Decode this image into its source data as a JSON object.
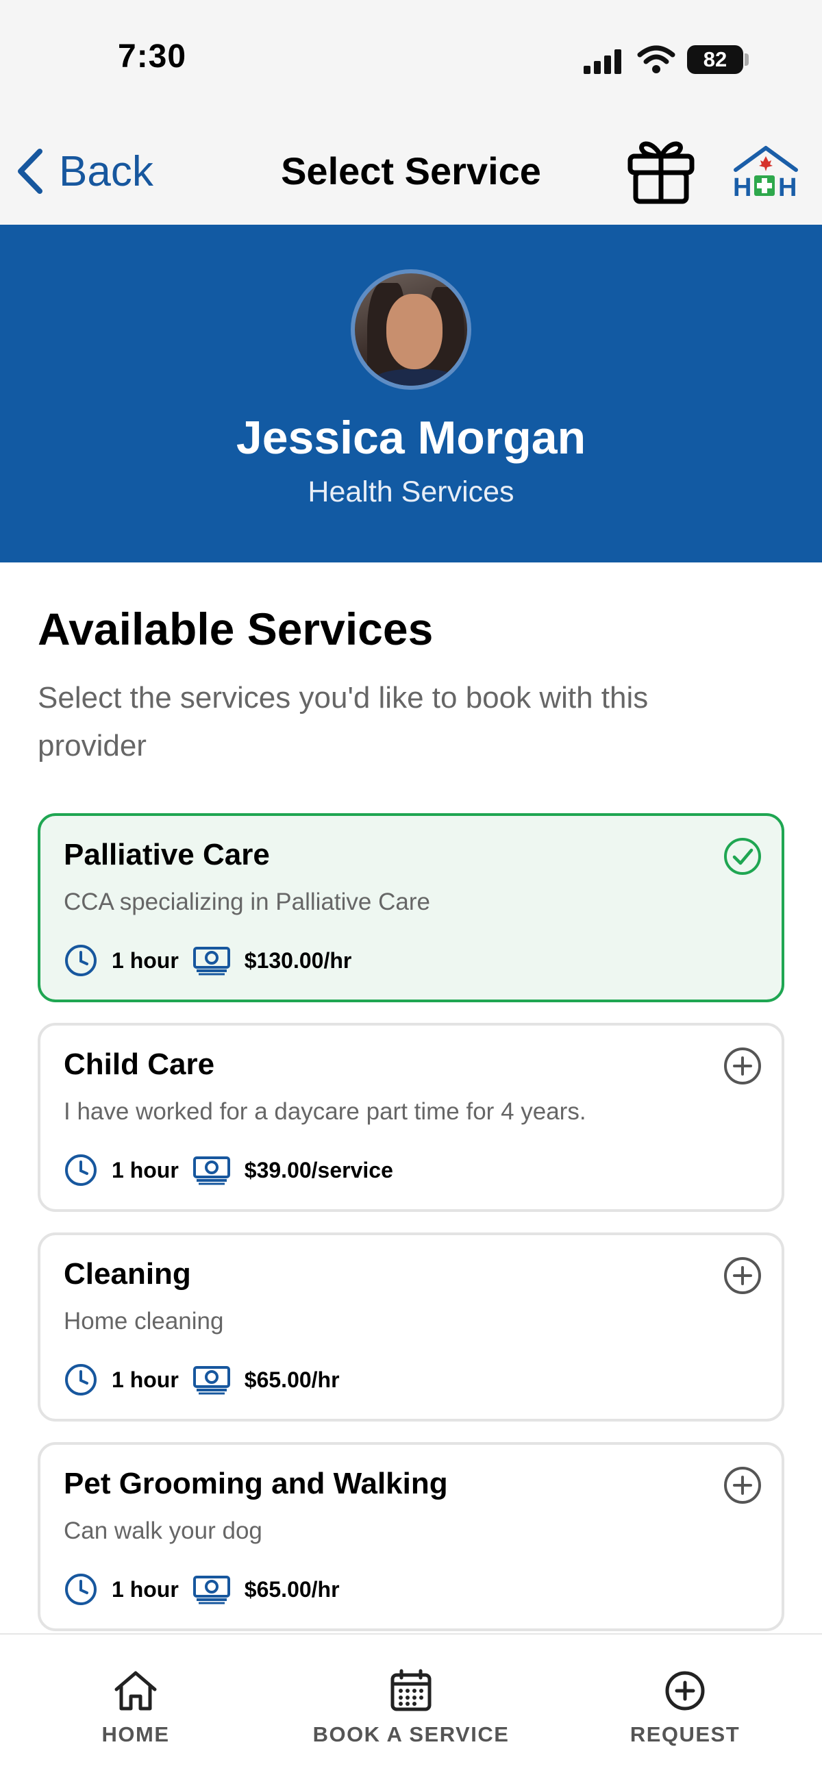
{
  "status_bar": {
    "time": "7:30",
    "battery": "82"
  },
  "nav": {
    "back_label": "Back",
    "title": "Select Service",
    "gift_icon": "gift-icon",
    "logo_icon": "home-health-logo"
  },
  "provider": {
    "name": "Jessica Morgan",
    "category": "Health Services"
  },
  "section": {
    "title": "Available Services",
    "subtitle": "Select the services you'd like to book with this provider"
  },
  "services": [
    {
      "title": "Palliative Care",
      "description": "CCA specializing in Palliative Care",
      "duration": "1 hour",
      "price": "$130.00/hr",
      "selected": true
    },
    {
      "title": "Child Care",
      "description": "I have worked for a daycare part time for 4 years.",
      "duration": "1 hour",
      "price": "$39.00/service",
      "selected": false
    },
    {
      "title": "Cleaning",
      "description": "Home cleaning",
      "duration": "1 hour",
      "price": "$65.00/hr",
      "selected": false
    },
    {
      "title": "Pet Grooming and Walking",
      "description": "Can walk your dog",
      "duration": "1 hour",
      "price": "$65.00/hr",
      "selected": false
    }
  ],
  "tabs": {
    "home": "HOME",
    "book": "BOOK A SERVICE",
    "request": "REQUEST"
  },
  "colors": {
    "brand_blue": "#125aa3",
    "selected_green": "#1fa652",
    "link_blue": "#17579e"
  }
}
